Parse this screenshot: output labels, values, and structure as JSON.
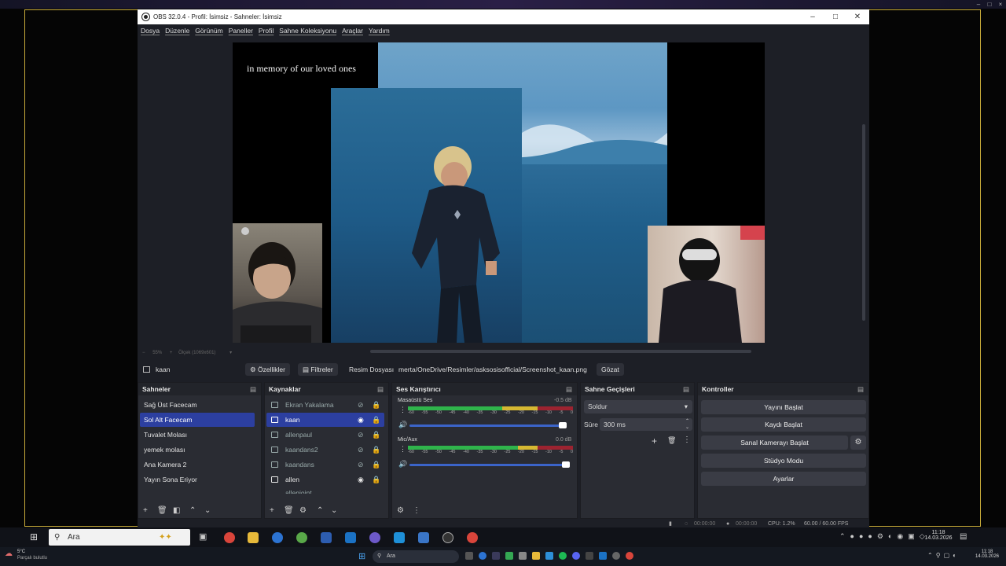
{
  "window": {
    "title": "OBS 32.0.4 - Profil: İsimsiz - Sahneler: İsimsiz"
  },
  "menu": [
    "Dosya",
    "Düzenle",
    "Görünüm",
    "Paneller",
    "Profil",
    "Sahne Koleksiyonu",
    "Araçlar",
    "Yardım"
  ],
  "preview": {
    "overlay_text": "in memory of our loved ones",
    "zoom": "55%",
    "scale_label": "Ölçek (1069x601)"
  },
  "source_bar": {
    "selected_source": "kaan",
    "properties": "Özellikler",
    "filters": "Filtreler",
    "image_label": "Resim Dosyası",
    "file_path": "merta/OneDrive/Resimler/asksosisofficial/Screenshot_kaan.png",
    "browse": "Gözat"
  },
  "scenes": {
    "title": "Sahneler",
    "items": [
      "Sağ Üst Facecam",
      "Sol Alt Facecam",
      "Tuvalet Molası",
      "yemek molası",
      "Ana Kamera 2",
      "Yayın Sona Eriyor"
    ],
    "selected_index": 1
  },
  "sources": {
    "title": "Kaynaklar",
    "items": [
      "Ekran Yakalama",
      "kaan",
      "allenpaul",
      "kaandans2",
      "kaandans",
      "allen",
      "allenjoint"
    ],
    "selected_index": 1
  },
  "mixer": {
    "title": "Ses Karıştırıcı",
    "channels": [
      {
        "name": "Masaüstü Ses",
        "db": "-0.5 dB"
      },
      {
        "name": "Mic/Aux",
        "db": "0.0 dB"
      }
    ],
    "scale": [
      "-60",
      "-55",
      "-50",
      "-45",
      "-40",
      "-35",
      "-30",
      "-25",
      "-20",
      "-15",
      "-10",
      "-5",
      "0"
    ]
  },
  "transitions": {
    "title": "Sahne Geçişleri",
    "type": "Soldur",
    "duration_label": "Süre",
    "duration": "300 ms"
  },
  "controls": {
    "title": "Kontroller",
    "buttons": [
      "Yayını Başlat",
      "Kaydı Başlat",
      "Sanal Kamerayı Başlat",
      "Stüdyo Modu",
      "Ayarlar"
    ]
  },
  "status": {
    "rec_time": "00:00:00",
    "stream_time": "00:00:00",
    "cpu": "CPU: 1.2%",
    "fps": "60.00 / 60.00 FPS"
  },
  "taskbar": {
    "search": "Ara",
    "time": "11:18",
    "date": "14.03.2026"
  },
  "bottom_taskbar": {
    "weather_temp": "5°C",
    "weather_text": "Parçalı bulutlu",
    "search": "Ara",
    "time": "11:18",
    "date": "14.03.2026"
  },
  "colors": {
    "accent": "#2c3fa0",
    "panel": "#2a2c33",
    "frame": "#c9ac3a"
  }
}
